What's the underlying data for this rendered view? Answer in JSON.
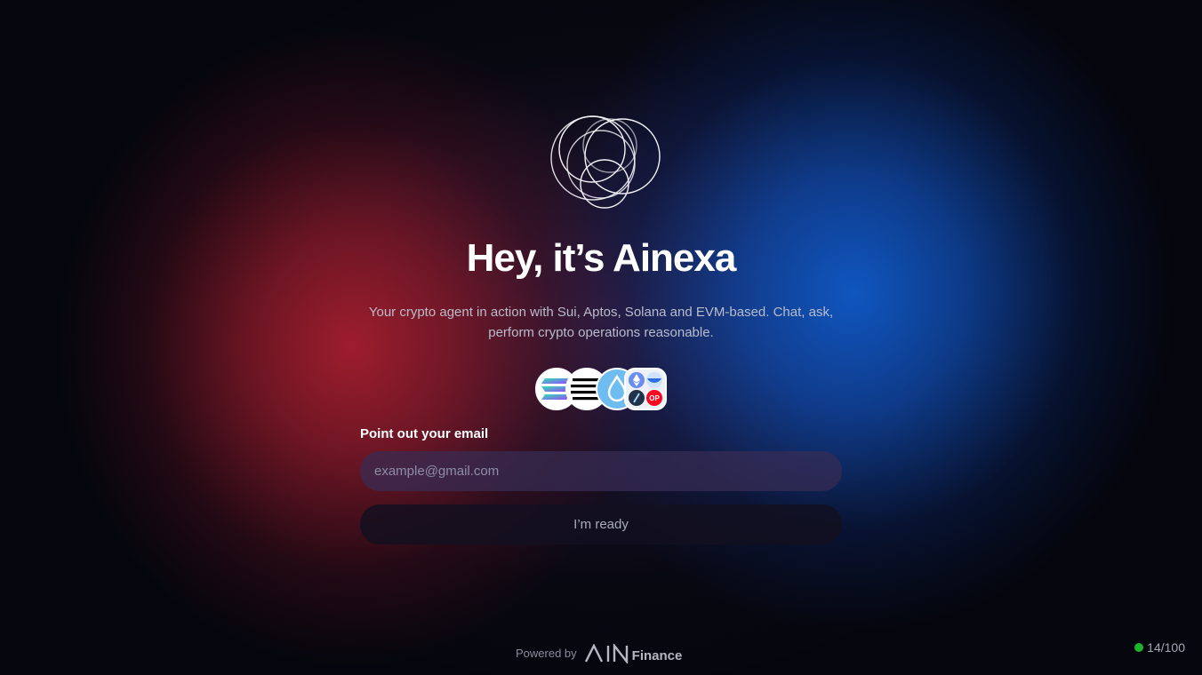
{
  "hero": {
    "title": "Hey, it’s Ainexa",
    "subtitle": "Your crypto agent in action with Sui, Aptos, Solana and EVM-based. Chat, ask, perform crypto operations reasonable."
  },
  "chains": [
    {
      "name": "Solana",
      "icon": "solana-icon"
    },
    {
      "name": "Aptos",
      "icon": "aptos-icon"
    },
    {
      "name": "Sui",
      "icon": "sui-icon"
    },
    {
      "name": "EVM",
      "icon": "evm-chains-icon"
    }
  ],
  "form": {
    "email_label": "Point out your email",
    "email_placeholder": "example@gmail.com",
    "email_value": "",
    "submit_label": "I’m ready"
  },
  "footer": {
    "powered_by": "Powered by",
    "brand_mark": "AIN",
    "brand_word": "Finance"
  },
  "status": {
    "counter": "14/100",
    "dot_color": "#1db52c"
  },
  "colors": {
    "red_glow": "#a51e2d",
    "blue_glow": "#0f5ac8",
    "background": "#05060d"
  }
}
